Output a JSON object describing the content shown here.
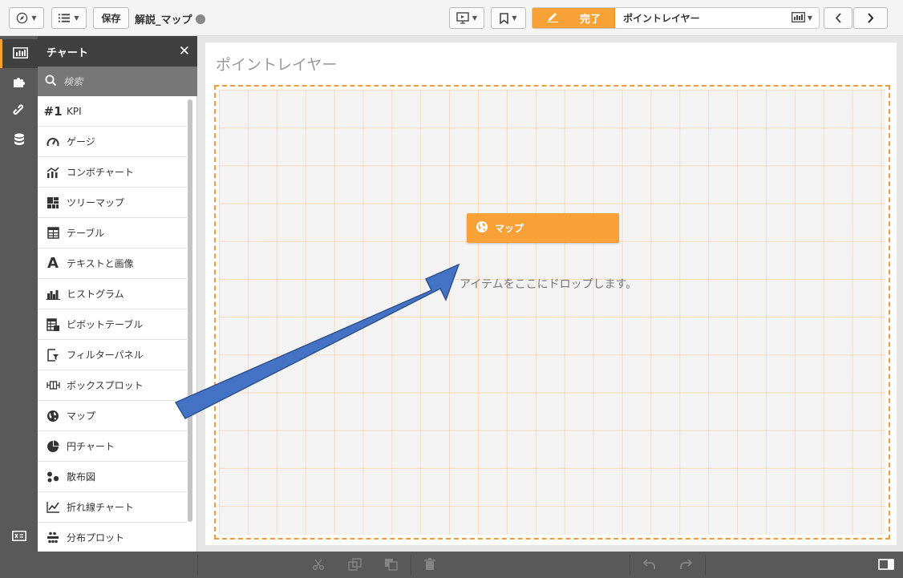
{
  "toolbar": {
    "save_label": "保存",
    "app_title": "解説_マップ",
    "done_label": "完了",
    "sheet_title": "ポイントレイヤー"
  },
  "panel": {
    "header": "チャート",
    "search_placeholder": "検索",
    "items": [
      {
        "icon": "kpi-icon",
        "label": "KPI"
      },
      {
        "icon": "gauge-icon",
        "label": "ゲージ"
      },
      {
        "icon": "combo-chart-icon",
        "label": "コンボチャート"
      },
      {
        "icon": "treemap-icon",
        "label": "ツリーマップ"
      },
      {
        "icon": "table-icon",
        "label": "テーブル"
      },
      {
        "icon": "text-image-icon",
        "label": "テキストと画像"
      },
      {
        "icon": "histogram-icon",
        "label": "ヒストグラム"
      },
      {
        "icon": "pivot-table-icon",
        "label": "ピボットテーブル"
      },
      {
        "icon": "filter-pane-icon",
        "label": "フィルターパネル"
      },
      {
        "icon": "box-plot-icon",
        "label": "ボックスプロット"
      },
      {
        "icon": "map-icon",
        "label": "マップ"
      },
      {
        "icon": "pie-chart-icon",
        "label": "円チャート"
      },
      {
        "icon": "scatter-plot-icon",
        "label": "散布図"
      },
      {
        "icon": "line-chart-icon",
        "label": "折れ線チャート"
      },
      {
        "icon": "distribution-plot-icon",
        "label": "分布プロット"
      }
    ]
  },
  "main": {
    "title": "ポイントレイヤー",
    "drag_chip_label": "マップ",
    "drop_hint": "アイテムをここにドロップします。"
  },
  "colors": {
    "accent": "#f7a136",
    "panel_dark": "#404040",
    "strip": "#595959",
    "arrow": "#4472c4"
  }
}
